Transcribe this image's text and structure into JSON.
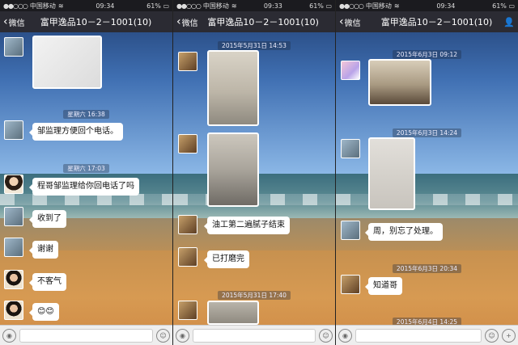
{
  "panel1": {
    "status": {
      "carrier": "中国移动",
      "time": "09:34",
      "battery": "61%"
    },
    "nav": {
      "back": "微信",
      "title": "富甲逸品10－2－1001(10)"
    },
    "timestamps": [
      "星期六 16:38",
      "星期六 17:03"
    ],
    "messages": [
      "邹监理方便回个电话。",
      "程哥邹监理给你回电话了吗",
      "收到了",
      "谢谢",
      "不客气",
      "😊😊"
    ]
  },
  "panel2": {
    "status": {
      "carrier": "中国移动",
      "time": "09:33",
      "battery": "61%"
    },
    "nav": {
      "back": "微信",
      "title": "富甲逸品10－2－1001(10)"
    },
    "timestamps": [
      "2015年5月31日 14:53",
      "2015年5月31日 17:40"
    ],
    "messages": [
      "油工第二遍腻子结束",
      "已打磨完"
    ]
  },
  "panel3": {
    "status": {
      "carrier": "中国移动",
      "time": "09:34",
      "battery": "61%"
    },
    "nav": {
      "back": "微信",
      "title": "富甲逸品10－2－1001(10)"
    },
    "timestamps": [
      "2015年6月3日 09:12",
      "2015年6月3日 14:24",
      "2015年6月3日 20:34",
      "2015年6月4日 14:25"
    ],
    "messages": [
      "周，别忘了处理。",
      "知道哥"
    ]
  },
  "icons": {
    "back": "chevron-left-icon",
    "voice": "voice-icon",
    "emoji": "emoji-icon",
    "add": "plus-icon",
    "contacts": "person-icon"
  }
}
